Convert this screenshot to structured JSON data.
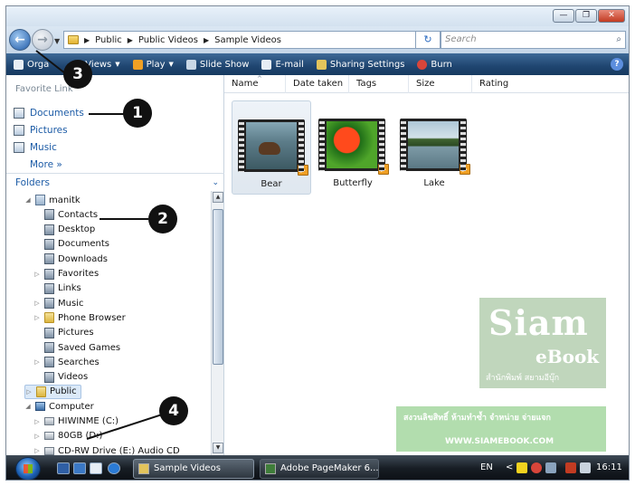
{
  "window": {
    "buttons": {
      "minimize": "—",
      "maximize": "❐",
      "close": "✕"
    }
  },
  "address": {
    "crumbs": [
      "Public",
      "Public Videos",
      "Sample Videos"
    ],
    "search_placeholder": "Search"
  },
  "toolbar": {
    "items": [
      {
        "label": "Organize",
        "icon": "organize-icon"
      },
      {
        "label": "Views",
        "icon": "views-icon"
      },
      {
        "label": "Play",
        "icon": "play-icon"
      },
      {
        "label": "Slide Show",
        "icon": "slideshow-icon"
      },
      {
        "label": "E-mail",
        "icon": "email-icon"
      },
      {
        "label": "Sharing Settings",
        "icon": "sharing-icon"
      },
      {
        "label": "Burn",
        "icon": "burn-icon"
      }
    ],
    "organize_visible": "Orga",
    "help": "?"
  },
  "favorites": {
    "title": "Favorite Links",
    "title_visible": "Favorite Link",
    "links": [
      "Documents",
      "Pictures",
      "Music"
    ],
    "more": "More"
  },
  "folders": {
    "header": "Folders",
    "tree": [
      {
        "label": "manitk",
        "type": "user",
        "level": 1,
        "expander": "◢"
      },
      {
        "label": "Contacts",
        "type": "sys",
        "level": 2,
        "expander": ""
      },
      {
        "label": "Desktop",
        "type": "sys",
        "level": 2,
        "expander": ""
      },
      {
        "label": "Documents",
        "type": "sys",
        "level": 2,
        "expander": ""
      },
      {
        "label": "Downloads",
        "type": "sys",
        "level": 2,
        "expander": ""
      },
      {
        "label": "Favorites",
        "type": "sys",
        "level": 2,
        "expander": "▷"
      },
      {
        "label": "Links",
        "type": "sys",
        "level": 2,
        "expander": ""
      },
      {
        "label": "Music",
        "type": "sys",
        "level": 2,
        "expander": "▷"
      },
      {
        "label": "Phone Browser",
        "type": "folder",
        "level": 2,
        "expander": "▷"
      },
      {
        "label": "Pictures",
        "type": "sys",
        "level": 2,
        "expander": ""
      },
      {
        "label": "Saved Games",
        "type": "sys",
        "level": 2,
        "expander": ""
      },
      {
        "label": "Searches",
        "type": "sys",
        "level": 2,
        "expander": "▷"
      },
      {
        "label": "Videos",
        "type": "sys",
        "level": 2,
        "expander": ""
      },
      {
        "label": "Public",
        "type": "folder",
        "level": 1,
        "expander": "▷"
      },
      {
        "label": "Computer",
        "type": "pc",
        "level": 1,
        "expander": "◢"
      },
      {
        "label": "HIWINME (C:)",
        "type": "drive",
        "level": 2,
        "expander": "▷"
      },
      {
        "label": "80GB (D:)",
        "type": "drive",
        "level": 2,
        "expander": "▷"
      },
      {
        "label": "CD-RW Drive (E:) Audio CD",
        "type": "drive",
        "level": 2,
        "expander": "▷"
      }
    ]
  },
  "columns": [
    "Name",
    "Date taken",
    "Tags",
    "Size",
    "Rating"
  ],
  "files": [
    {
      "name": "Bear",
      "selected": true
    },
    {
      "name": "Butterfly",
      "selected": false
    },
    {
      "name": "Lake",
      "selected": false
    }
  ],
  "watermark": {
    "brand": "Siam",
    "sub": "eBook",
    "publisher": "สำนักพิมพ์ สยามอีบุ๊ก",
    "copyright": "สงวนลิขสิทธิ์ ห้ามทำซ้ำ จำหน่าย จ่ายแจก",
    "url": "WWW.SIAMEBOOK.COM"
  },
  "callouts": [
    "1",
    "2",
    "3",
    "4"
  ],
  "taskbar": {
    "tasks": [
      "Sample Videos",
      "Adobe PageMaker 6..."
    ],
    "lang": "EN",
    "clock": "16:11",
    "chevron": "<"
  },
  "colors": {
    "toolbar": "#1f4570",
    "link": "#1c5ba6",
    "taskbar": "#171d24"
  }
}
